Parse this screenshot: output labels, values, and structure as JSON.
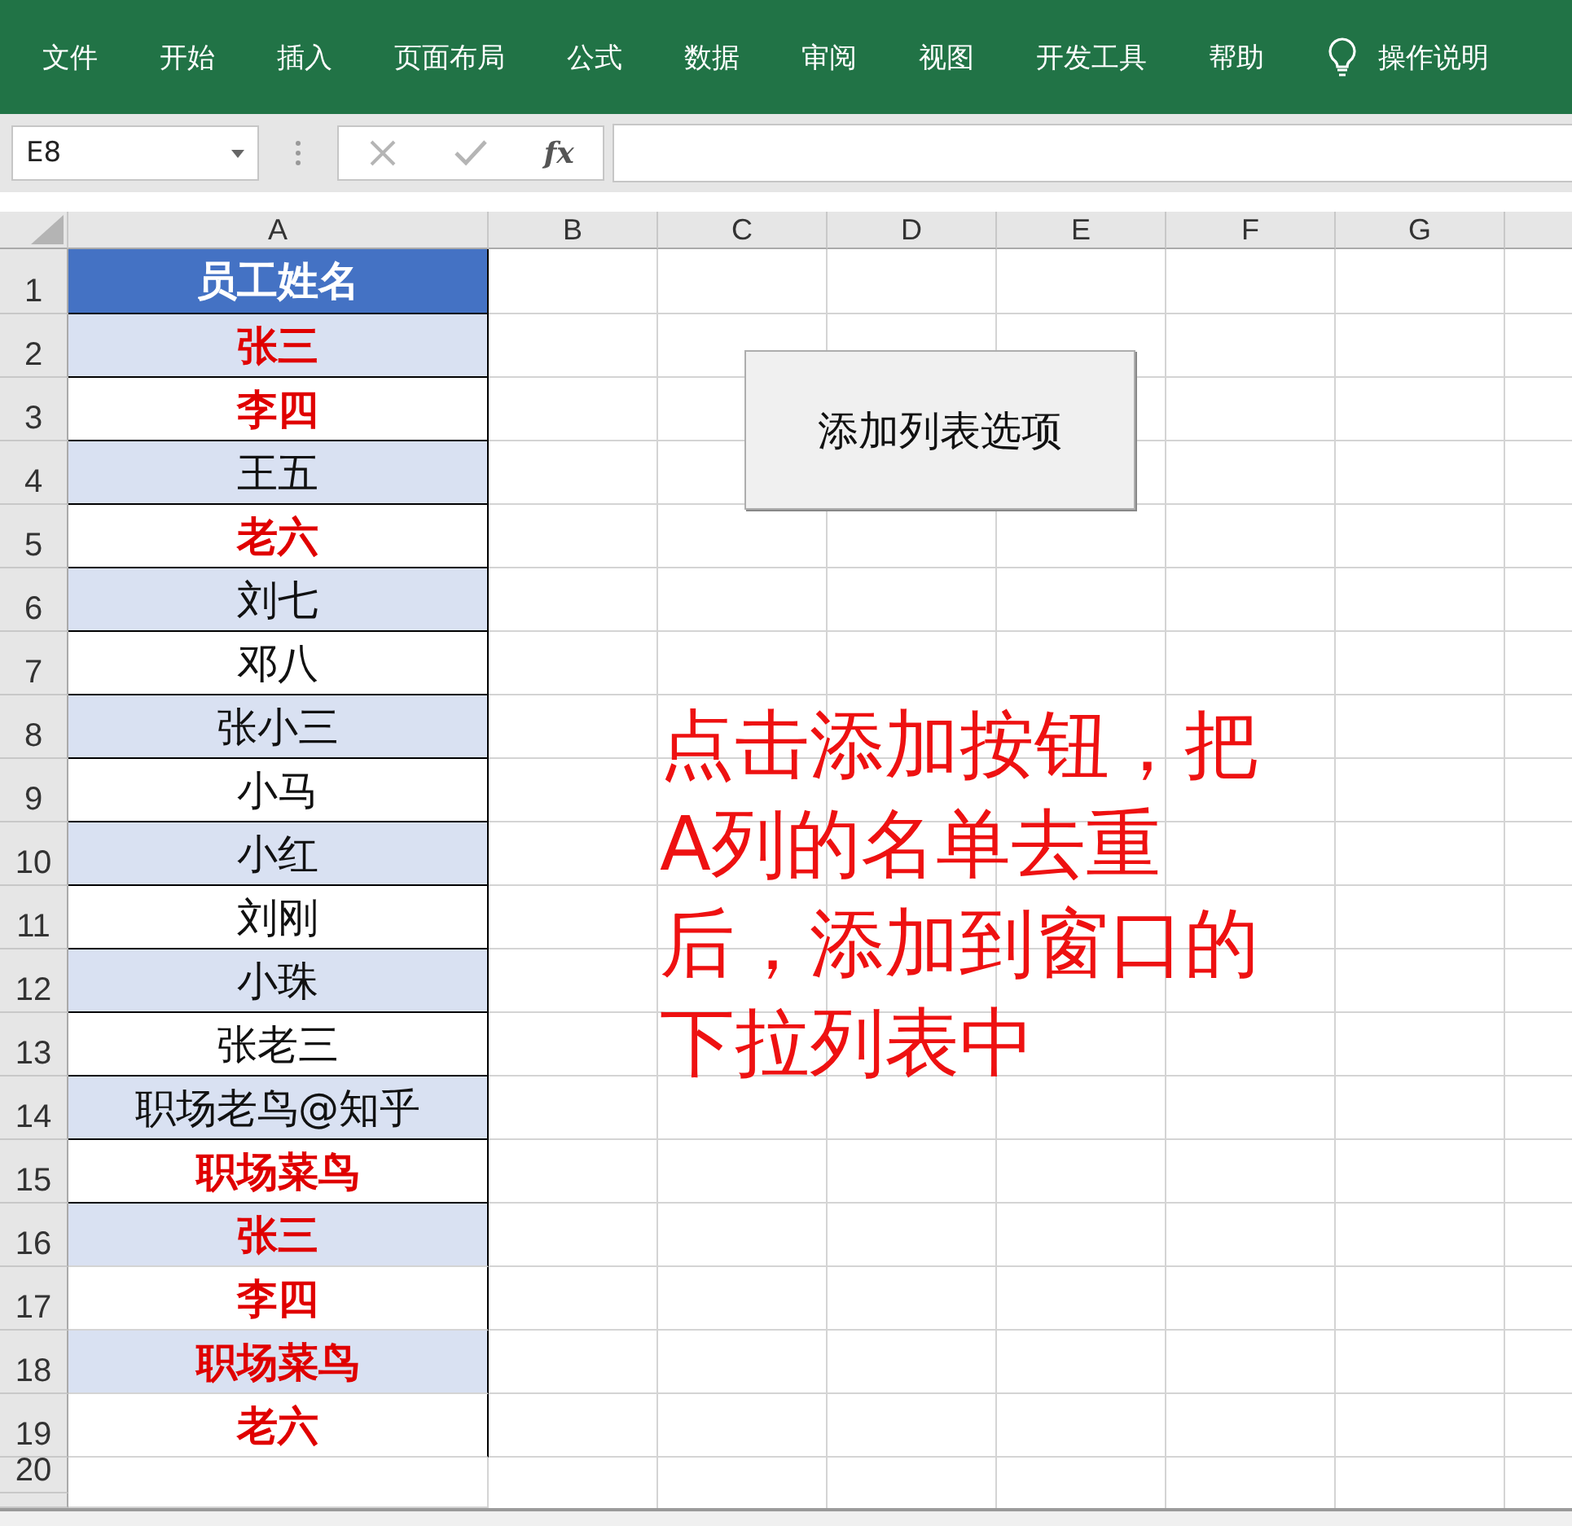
{
  "ribbon": {
    "tabs": [
      "文件",
      "开始",
      "插入",
      "页面布局",
      "公式",
      "数据",
      "审阅",
      "视图",
      "开发工具",
      "帮助"
    ],
    "tell_me": "操作说明"
  },
  "formula_bar": {
    "name_box": "E8",
    "function_label": "fx"
  },
  "sheet": {
    "columns": [
      "A",
      "B",
      "C",
      "D",
      "E",
      "F",
      "G"
    ],
    "header": {
      "number": "1",
      "text": "员工姓名"
    },
    "rows": [
      {
        "number": "2",
        "text": "张三",
        "highlighted": true,
        "shaded": true,
        "bordered": true
      },
      {
        "number": "3",
        "text": "李四",
        "highlighted": true,
        "shaded": false,
        "bordered": true
      },
      {
        "number": "4",
        "text": "王五",
        "highlighted": false,
        "shaded": true,
        "bordered": true
      },
      {
        "number": "5",
        "text": "老六",
        "highlighted": true,
        "shaded": false,
        "bordered": true
      },
      {
        "number": "6",
        "text": "刘七",
        "highlighted": false,
        "shaded": true,
        "bordered": true
      },
      {
        "number": "7",
        "text": "邓八",
        "highlighted": false,
        "shaded": false,
        "bordered": true
      },
      {
        "number": "8",
        "text": "张小三",
        "highlighted": false,
        "shaded": true,
        "bordered": true
      },
      {
        "number": "9",
        "text": "小马",
        "highlighted": false,
        "shaded": false,
        "bordered": true
      },
      {
        "number": "10",
        "text": "小红",
        "highlighted": false,
        "shaded": true,
        "bordered": true
      },
      {
        "number": "11",
        "text": "刘刚",
        "highlighted": false,
        "shaded": false,
        "bordered": true
      },
      {
        "number": "12",
        "text": "小珠",
        "highlighted": false,
        "shaded": true,
        "bordered": true
      },
      {
        "number": "13",
        "text": "张老三",
        "highlighted": false,
        "shaded": false,
        "bordered": true
      },
      {
        "number": "14",
        "text": "职场老鸟@知乎",
        "highlighted": false,
        "shaded": true,
        "bordered": true
      },
      {
        "number": "15",
        "text": "职场菜鸟",
        "highlighted": true,
        "shaded": false,
        "bordered": true
      },
      {
        "number": "16",
        "text": "张三",
        "highlighted": true,
        "shaded": true,
        "bordered": false
      },
      {
        "number": "17",
        "text": "李四",
        "highlighted": true,
        "shaded": false,
        "bordered": false
      },
      {
        "number": "18",
        "text": "职场菜鸟",
        "highlighted": true,
        "shaded": true,
        "bordered": false
      },
      {
        "number": "19",
        "text": "老六",
        "highlighted": true,
        "shaded": false,
        "bordered": false
      }
    ],
    "empty_rows": [
      "20"
    ],
    "button": "添加列表选项",
    "note_lines": [
      "点击添加按钮，把",
      "A列的名单去重",
      "后，添加到窗口的",
      "下拉列表中"
    ]
  }
}
